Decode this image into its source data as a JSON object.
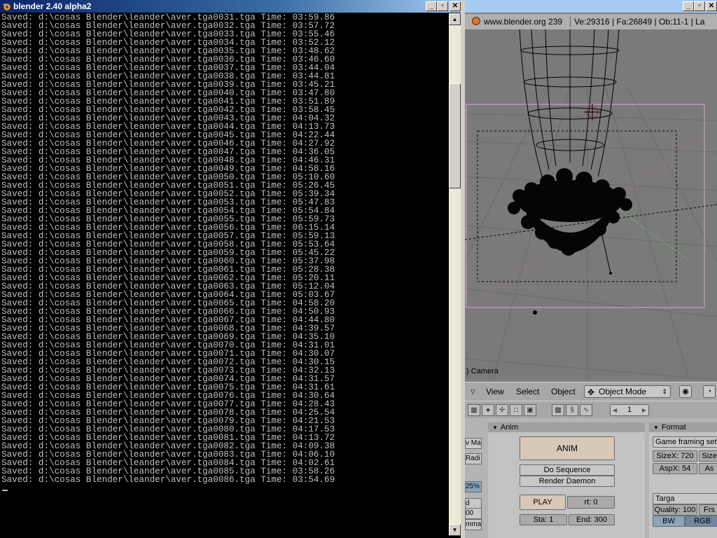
{
  "console": {
    "title": "blender 2.40 alpha2",
    "lines": [
      "Saved: d:\\cosas Blender\\leander\\aver.tga0031.tga Time: 03:59.86",
      "Saved: d:\\cosas Blender\\leander\\aver.tga0032.tga Time: 03:57.72",
      "Saved: d:\\cosas Blender\\leander\\aver.tga0033.tga Time: 03:55.46",
      "Saved: d:\\cosas Blender\\leander\\aver.tga0034.tga Time: 03:52.12",
      "Saved: d:\\cosas Blender\\leander\\aver.tga0035.tga Time: 03:48.62",
      "Saved: d:\\cosas Blender\\leander\\aver.tga0036.tga Time: 03:46.60",
      "Saved: d:\\cosas Blender\\leander\\aver.tga0037.tga Time: 03:44.04",
      "Saved: d:\\cosas Blender\\leander\\aver.tga0038.tga Time: 03:44.81",
      "Saved: d:\\cosas Blender\\leander\\aver.tga0039.tga Time: 03:45.21",
      "Saved: d:\\cosas Blender\\leander\\aver.tga0040.tga Time: 03:47.80",
      "Saved: d:\\cosas Blender\\leander\\aver.tga0041.tga Time: 03:51.89",
      "Saved: d:\\cosas Blender\\leander\\aver.tga0042.tga Time: 03:58.45",
      "Saved: d:\\cosas Blender\\leander\\aver.tga0043.tga Time: 04:04.32",
      "Saved: d:\\cosas Blender\\leander\\aver.tga0044.tga Time: 04:13.73",
      "Saved: d:\\cosas Blender\\leander\\aver.tga0045.tga Time: 04:22.44",
      "Saved: d:\\cosas Blender\\leander\\aver.tga0046.tga Time: 04:27.92",
      "Saved: d:\\cosas Blender\\leander\\aver.tga0047.tga Time: 04:36.05",
      "Saved: d:\\cosas Blender\\leander\\aver.tga0048.tga Time: 04:46.31",
      "Saved: d:\\cosas Blender\\leander\\aver.tga0049.tga Time: 04:58.16",
      "Saved: d:\\cosas Blender\\leander\\aver.tga0050.tga Time: 05:10.60",
      "Saved: d:\\cosas Blender\\leander\\aver.tga0051.tga Time: 05:26.45",
      "Saved: d:\\cosas Blender\\leander\\aver.tga0052.tga Time: 05:39.34",
      "Saved: d:\\cosas Blender\\leander\\aver.tga0053.tga Time: 05:47.83",
      "Saved: d:\\cosas Blender\\leander\\aver.tga0054.tga Time: 05:54.84",
      "Saved: d:\\cosas Blender\\leander\\aver.tga0055.tga Time: 05:59.73",
      "Saved: d:\\cosas Blender\\leander\\aver.tga0056.tga Time: 06:15.14",
      "Saved: d:\\cosas Blender\\leander\\aver.tga0057.tga Time: 05:59.13",
      "Saved: d:\\cosas Blender\\leander\\aver.tga0058.tga Time: 05:53.64",
      "Saved: d:\\cosas Blender\\leander\\aver.tga0059.tga Time: 05:45.22",
      "Saved: d:\\cosas Blender\\leander\\aver.tga0060.tga Time: 05:37.98",
      "Saved: d:\\cosas Blender\\leander\\aver.tga0061.tga Time: 05:28.38",
      "Saved: d:\\cosas Blender\\leander\\aver.tga0062.tga Time: 05:20.11",
      "Saved: d:\\cosas Blender\\leander\\aver.tga0063.tga Time: 05:12.04",
      "Saved: d:\\cosas Blender\\leander\\aver.tga0064.tga Time: 05:03.67",
      "Saved: d:\\cosas Blender\\leander\\aver.tga0065.tga Time: 04:58.20",
      "Saved: d:\\cosas Blender\\leander\\aver.tga0066.tga Time: 04:50.93",
      "Saved: d:\\cosas Blender\\leander\\aver.tga0067.tga Time: 04:44.80",
      "Saved: d:\\cosas Blender\\leander\\aver.tga0068.tga Time: 04:39.57",
      "Saved: d:\\cosas Blender\\leander\\aver.tga0069.tga Time: 04:35.10",
      "Saved: d:\\cosas Blender\\leander\\aver.tga0070.tga Time: 04:31.01",
      "Saved: d:\\cosas Blender\\leander\\aver.tga0071.tga Time: 04:30.07",
      "Saved: d:\\cosas Blender\\leander\\aver.tga0072.tga Time: 04:30.15",
      "Saved: d:\\cosas Blender\\leander\\aver.tga0073.tga Time: 04:32.13",
      "Saved: d:\\cosas Blender\\leander\\aver.tga0074.tga Time: 04:31.57",
      "Saved: d:\\cosas Blender\\leander\\aver.tga0075.tga Time: 04:31.61",
      "Saved: d:\\cosas Blender\\leander\\aver.tga0076.tga Time: 04:30.64",
      "Saved: d:\\cosas Blender\\leander\\aver.tga0077.tga Time: 04:28.43",
      "Saved: d:\\cosas Blender\\leander\\aver.tga0078.tga Time: 04:25.54",
      "Saved: d:\\cosas Blender\\leander\\aver.tga0079.tga Time: 04:21.53",
      "Saved: d:\\cosas Blender\\leander\\aver.tga0080.tga Time: 04:17.53",
      "Saved: d:\\cosas Blender\\leander\\aver.tga0081.tga Time: 04:13.72",
      "Saved: d:\\cosas Blender\\leander\\aver.tga0082.tga Time: 04:09.38",
      "Saved: d:\\cosas Blender\\leander\\aver.tga0083.tga Time: 04:06.10",
      "Saved: d:\\cosas Blender\\leander\\aver.tga0084.tga Time: 04:02.61",
      "Saved: d:\\cosas Blender\\leander\\aver.tga0085.tga Time: 03:58.26",
      "Saved: d:\\cosas Blender\\leander\\aver.tga0086.tga Time: 03:54.69"
    ],
    "buttons": {
      "minimize": "_",
      "maximize": "▫",
      "close": "✕"
    }
  },
  "blender": {
    "header": {
      "url": "www.blender.org 239",
      "stats": "Ve:29316 | Fa:26849 | Ob:11-1 | La"
    },
    "viewport": {
      "object_label": ") Camera"
    },
    "view_header": {
      "menus": [
        "View",
        "Select",
        "Object"
      ],
      "mode": "Object Mode"
    },
    "buttons_header": {
      "frame": "1"
    },
    "anim_panel": {
      "title": "Anim",
      "anim_button": "ANIM",
      "do_sequence": "Do Sequence",
      "render_daemon": "Render Daemon",
      "play_button": "PLAY",
      "rt_field": "rt: 0",
      "sta_field": "Sta: 1",
      "end_field": "End: 300"
    },
    "format_panel": {
      "title": "Format",
      "preset": "Game framing settin",
      "size_x": "SizeX: 720",
      "size_y": "Size",
      "asp_x": "AspX: 54",
      "asp_y": "As",
      "file_type": "Targa",
      "quality": "Quality: 100",
      "frs": "Frs",
      "bw": "BW",
      "rgb": "RGB"
    },
    "left_stubs": [
      "v Ma",
      "Radi",
      "25%",
      "d",
      "00",
      "mma"
    ]
  }
}
